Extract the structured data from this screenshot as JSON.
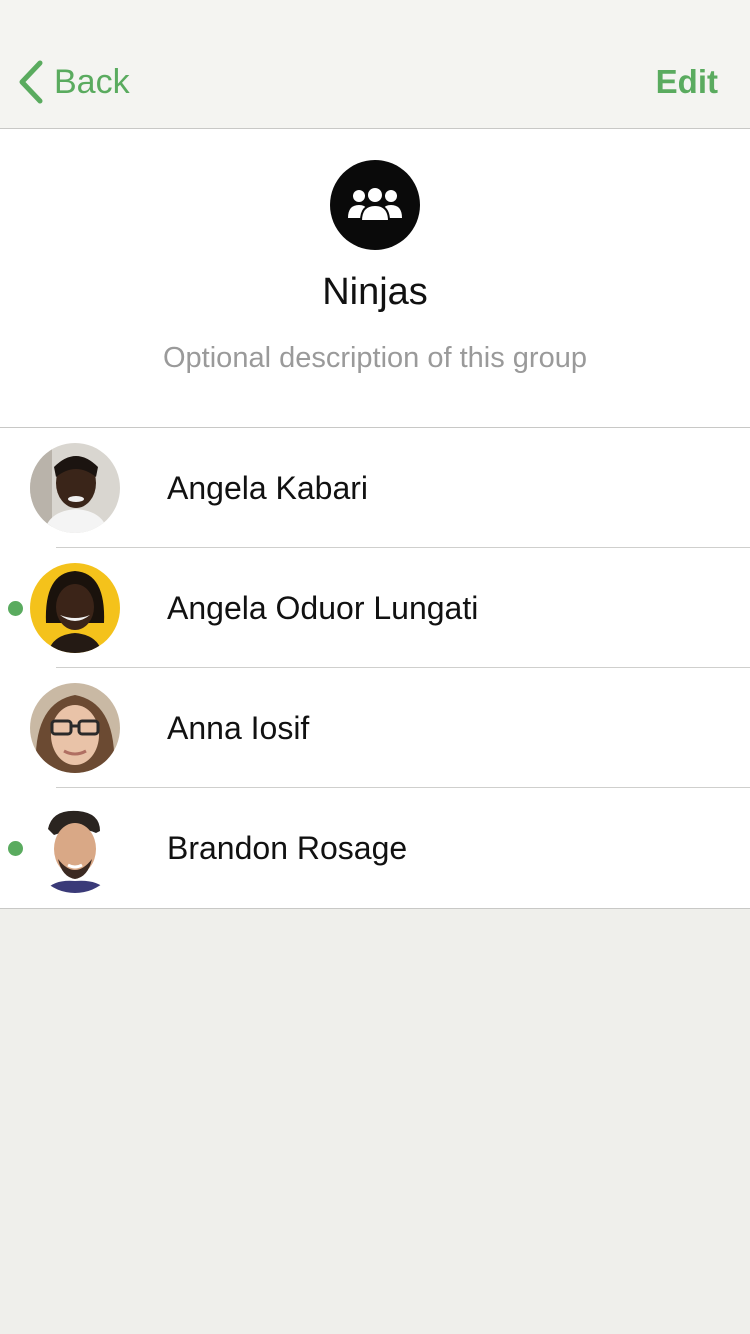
{
  "nav": {
    "back_label": "Back",
    "edit_label": "Edit",
    "accent_color": "#5aab5f"
  },
  "group": {
    "icon": "group-people-icon",
    "name": "Ninjas",
    "description": "Optional description of this group"
  },
  "members": [
    {
      "name": "Angela Kabari",
      "online": false
    },
    {
      "name": "Angela Oduor Lungati",
      "online": true
    },
    {
      "name": "Anna Iosif",
      "online": false
    },
    {
      "name": "Brandon Rosage",
      "online": true
    }
  ]
}
